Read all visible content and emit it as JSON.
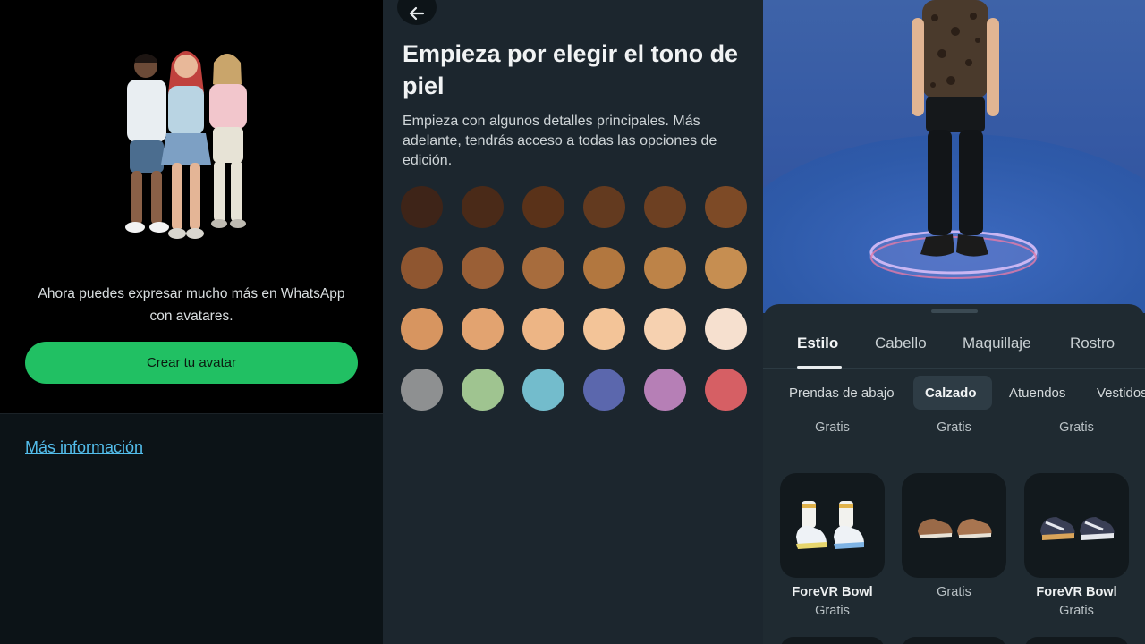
{
  "panel1": {
    "description": "Ahora puedes expresar mucho más en WhatsApp con avatares.",
    "create_button": "Crear tu avatar",
    "more_info_link": "Más información",
    "accent": "#21c063"
  },
  "panel2": {
    "title": "Empieza por elegir el tono de piel",
    "subtitle": "Empieza con algunos detalles principales. Más adelante, tendrás acceso a todas las opciones de edición.",
    "back_icon": "arrow-left-icon",
    "swatch_colors": [
      [
        "#3e2418",
        "#4a2a18",
        "#5a3219",
        "#633a1f",
        "#6d4022",
        "#7d4a26"
      ],
      [
        "#8f5630",
        "#9a5f36",
        "#a76c3d",
        "#b2773f",
        "#bd8348",
        "#c68e51"
      ],
      [
        "#d79560",
        "#e2a370",
        "#edb585",
        "#f3c498",
        "#f6d1b0",
        "#f6e0cf"
      ],
      [
        "#8e9091",
        "#9fc490",
        "#73bccc",
        "#5b67ad",
        "#b67fb6",
        "#d65f64"
      ]
    ]
  },
  "panel3": {
    "tabs": [
      "Estilo",
      "Cabello",
      "Maquillaje",
      "Rostro"
    ],
    "active_tab": "Estilo",
    "subtabs": [
      "Prendas de abajo",
      "Calzado",
      "Atuendos",
      "Vestidos"
    ],
    "active_subtab": "Calzado",
    "top_prices": [
      "Gratis",
      "Gratis",
      "Gratis"
    ],
    "cards": [
      {
        "name": "ForeVR Bowl",
        "price": "Gratis",
        "icon": "socks-sneakers-icon"
      },
      {
        "name": "",
        "price": "Gratis",
        "icon": "loafers-icon"
      },
      {
        "name": "ForeVR Bowl",
        "price": "Gratis",
        "icon": "sneakers-icon"
      }
    ]
  }
}
